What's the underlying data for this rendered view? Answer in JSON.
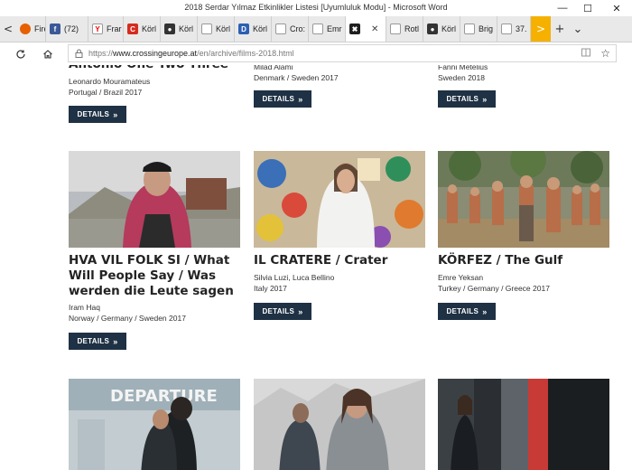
{
  "window": {
    "title": "2018 Serdar Yılmaz Etkinlikler Listesi [Uyumluluk Modu] - Microsoft Word",
    "minimize": "—",
    "maximize": "☐",
    "close": "✕"
  },
  "tabs": [
    {
      "label": "Fire",
      "icon": "firefox-icon",
      "color": "#e66000",
      "glyph": ""
    },
    {
      "label": "(72)",
      "icon": "facebook-icon",
      "color": "#3b5998",
      "glyph": "f"
    },
    {
      "label": "Frar",
      "icon": "yandex-icon",
      "color": "#ffffff",
      "glyph": "Y"
    },
    {
      "label": "Körl",
      "icon": "c-logo-icon",
      "color": "#d52b1e",
      "glyph": "C"
    },
    {
      "label": "Körl",
      "icon": "github-icon",
      "color": "#333333",
      "glyph": "●"
    },
    {
      "label": "Körl",
      "icon": "page-icon",
      "color": "#ffffff",
      "glyph": ""
    },
    {
      "label": "Körl",
      "icon": "d-logo-icon",
      "color": "#2c5fb3",
      "glyph": "D"
    },
    {
      "label": "Cro:",
      "icon": "page-icon",
      "color": "#ffffff",
      "glyph": ""
    },
    {
      "label": "Emr",
      "icon": "page-icon",
      "color": "#ffffff",
      "glyph": ""
    },
    {
      "label": "",
      "icon": "crossing-europe-icon",
      "color": "#1f1f1f",
      "glyph": "✖",
      "active": true
    },
    {
      "label": "Rotl",
      "icon": "page-icon",
      "color": "#ffffff",
      "glyph": ""
    },
    {
      "label": "Körl",
      "icon": "github-icon",
      "color": "#333333",
      "glyph": "●"
    },
    {
      "label": "Brig",
      "icon": "page-icon",
      "color": "#ffffff",
      "glyph": ""
    },
    {
      "label": "37.",
      "icon": "page-icon",
      "color": "#ffffff",
      "glyph": ""
    }
  ],
  "tabbar": {
    "back": "<",
    "forward": ">",
    "new_tab": "+",
    "more": "⌄"
  },
  "address": {
    "scheme": "https://",
    "host": "www.crossingeurope.at",
    "path": "/en/archive/films-2018.html"
  },
  "films": [
    {
      "title": "Antonio One Two Three",
      "director": "Leonardo Mouramateus",
      "country": "Portugal / Brazil 2017",
      "button": "DETAILS"
    },
    {
      "title": "",
      "director": "Milad Alami",
      "country": "Denmark / Sweden 2017",
      "button": "DETAILS"
    },
    {
      "title": "",
      "director": "Fanni Metelius",
      "country": "Sweden 2018",
      "button": "DETAILS"
    },
    {
      "title": "HVA VIL FOLK SI / What Will People Say / Was werden die Leute sagen",
      "director": "Iram Haq",
      "country": "Norway / Germany / Sweden 2017",
      "button": "DETAILS"
    },
    {
      "title": "IL CRATERE / Crater",
      "director": "Silvia Luzi, Luca Bellino",
      "country": "Italy 2017",
      "button": "DETAILS"
    },
    {
      "title": "KÖRFEZ / The Gulf",
      "director": "Emre Yeksan",
      "country": "Turkey / Germany / Greece 2017",
      "button": "DETAILS"
    }
  ],
  "signs": {
    "departure": "DEPARTURE"
  }
}
